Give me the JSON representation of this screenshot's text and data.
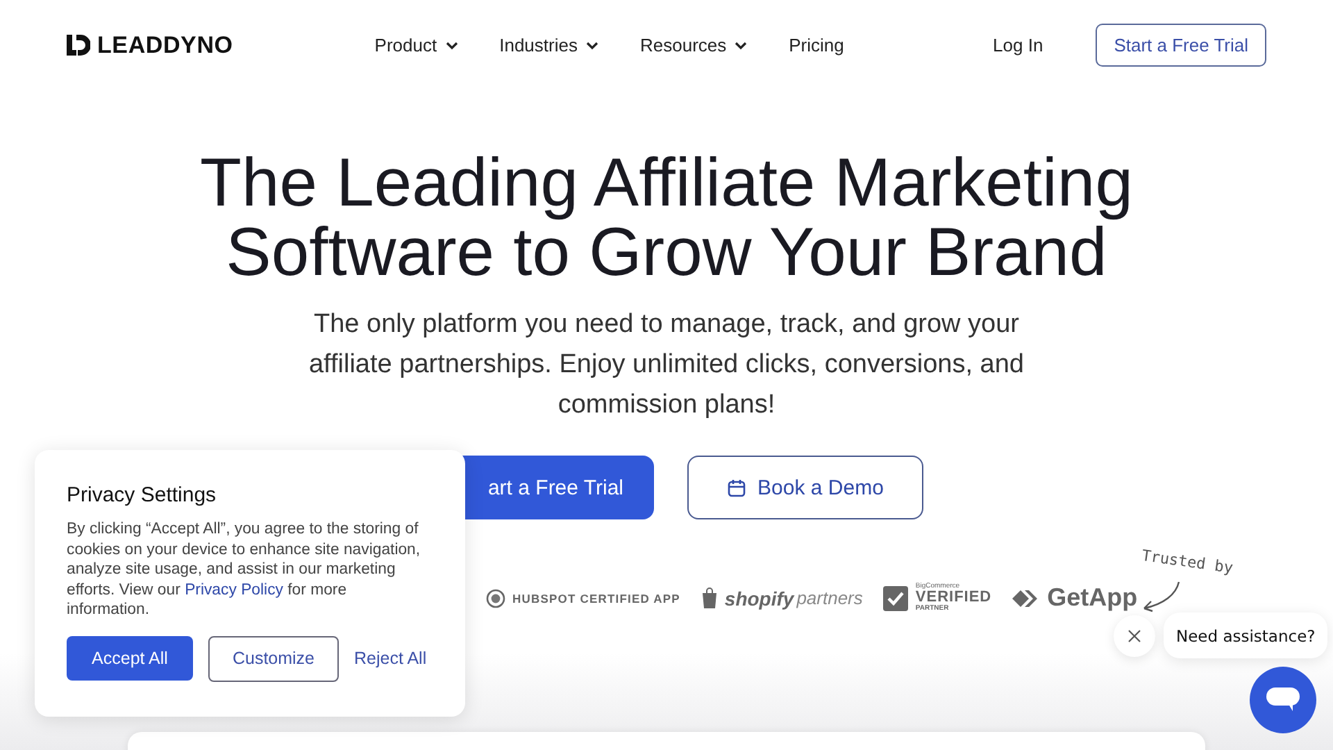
{
  "header": {
    "logo": "LEADDYNO",
    "nav": [
      {
        "label": "Product",
        "dropdown": true
      },
      {
        "label": "Industries",
        "dropdown": true
      },
      {
        "label": "Resources",
        "dropdown": true
      },
      {
        "label": "Pricing",
        "dropdown": false
      }
    ],
    "login": "Log In",
    "trial": "Start a Free Trial"
  },
  "hero": {
    "title_lines": [
      "The Leading Affiliate Marketing",
      "Software to Grow Your Brand"
    ],
    "subtitle": "The only platform you need to manage, track, and grow your affiliate partnerships. Enjoy unlimited clicks, conversions, and commission plans!",
    "primary_button": "art a Free Trial",
    "demo_button": "Book a Demo"
  },
  "trust": {
    "note": "Trusted by",
    "logos": [
      {
        "kind": "hubspot",
        "text": "HUBSPOT CERTIFIED APP"
      },
      {
        "kind": "shopify",
        "text": "shopify",
        "text2": "partners"
      },
      {
        "kind": "bigcommerce",
        "small": "BigCommerce",
        "text": "VERIFIED",
        "text2": "PARTNER"
      },
      {
        "kind": "getapp",
        "text": "GetApp"
      }
    ]
  },
  "cookie": {
    "title": "Privacy Settings",
    "body": "By clicking “Accept All”, you agree to the storing of cookies on your device to enhance site navigation, analyze site usage, and assist in our marketing efforts. View our ",
    "link": "Privacy Policy",
    "body_end": " for more information.",
    "accept": "Accept All",
    "customize": "Customize",
    "reject": "Reject All"
  },
  "chat": {
    "prompt": "Need assistance?"
  }
}
